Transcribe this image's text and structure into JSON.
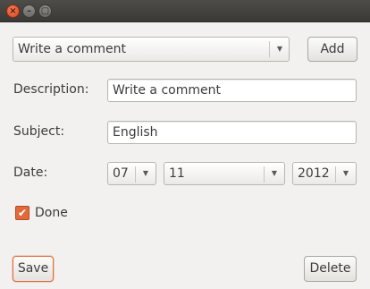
{
  "window": {
    "close_glyph": "×",
    "minimize_glyph": "–",
    "maximize_glyph": "▢"
  },
  "top": {
    "combo_value": "Write a comment",
    "add_label": "Add"
  },
  "form": {
    "description_label": "Description:",
    "description_value": "Write a comment",
    "subject_label": "Subject:",
    "subject_value": "English",
    "date_label": "Date:",
    "date_day": "07",
    "date_month": "11",
    "date_year": "2012",
    "done_label": "Done",
    "done_checked": "✔"
  },
  "actions": {
    "save_label": "Save",
    "delete_label": "Delete"
  },
  "colors": {
    "accent": "#e16a3d",
    "window_bg": "#f2f1f0",
    "titlebar": "#3c3b37"
  }
}
